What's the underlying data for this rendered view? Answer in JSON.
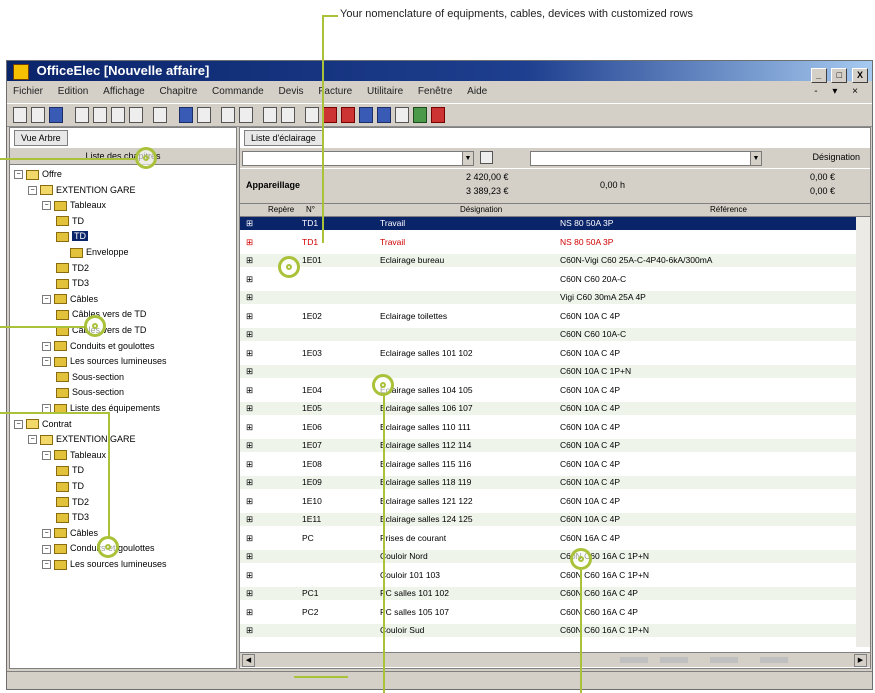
{
  "annotation": {
    "text": "Your nomenclature of equipments, cables, devices with customized rows"
  },
  "window": {
    "title": "OfficeElec   [Nouvelle affaire]",
    "controls": [
      "_",
      "□",
      "X"
    ]
  },
  "menubar": {
    "items": [
      "Fichier",
      "Edition",
      "Affichage",
      "Chapitre",
      "Commande",
      "Devis",
      "Facture",
      "Utilitaire",
      "Fenêtre",
      "Aide"
    ],
    "mdi_controls": "- ▾ ×"
  },
  "left_pane": {
    "tab": "Vue Arbre",
    "header": "Liste des chapitres",
    "tree": [
      {
        "label": "Offre",
        "depth": 0
      },
      {
        "label": "EXTENTION GARE",
        "depth": 1
      },
      {
        "label": "Tableaux",
        "depth": 2
      },
      {
        "label": "TD",
        "depth": 3
      },
      {
        "label": "TD",
        "depth": 3
      },
      {
        "label": "Enveloppe",
        "depth": 4
      },
      {
        "label": "TD2",
        "depth": 3
      },
      {
        "label": "TD3",
        "depth": 3
      },
      {
        "label": "Câbles",
        "depth": 2
      },
      {
        "label": "Câbles vers de TD",
        "depth": 3
      },
      {
        "label": "Câbles vers de TD",
        "depth": 3
      },
      {
        "label": "Conduits et goulottes",
        "depth": 2
      },
      {
        "label": "Les sources lumineuses",
        "depth": 2
      },
      {
        "label": "Sous-section",
        "depth": 3
      },
      {
        "label": "Sous-section",
        "depth": 3
      },
      {
        "label": "Liste des équipements",
        "depth": 2
      },
      {
        "label": "Contrat",
        "depth": 0
      },
      {
        "label": "EXTENTION GARE",
        "depth": 1
      },
      {
        "label": "Tableaux",
        "depth": 2
      },
      {
        "label": "TD",
        "depth": 3
      },
      {
        "label": "TD",
        "depth": 3
      },
      {
        "label": "TD2",
        "depth": 3
      },
      {
        "label": "TD3",
        "depth": 3
      },
      {
        "label": "Câbles",
        "depth": 2
      },
      {
        "label": "Conduits et goulottes",
        "depth": 2
      },
      {
        "label": "Les sources lumineuses",
        "depth": 2
      }
    ]
  },
  "right_pane": {
    "tab": "Liste d'éclairage",
    "filter_label": "Désignation",
    "summary": {
      "title": "Appareillage",
      "value_top": "2 420,00 €",
      "value_bottom": "3 389,23 €",
      "mid": "0,00 h",
      "right_top": "0,00 €",
      "right_bottom": "0,00 €"
    },
    "columns": [
      "Repère",
      "N°",
      "Désignation",
      "Référence"
    ],
    "rows": [
      {
        "ref": "TD1",
        "name": "Travail",
        "detail": "NS 80 50A 3P",
        "style": "sel"
      },
      {
        "ref": "TD1",
        "name": "Travail",
        "detail": "NS 80 50A 3P",
        "style": "red"
      },
      {
        "ref": "1E01",
        "name": "Eclairage bureau",
        "detail": "C60N-Vigi C60 25A-C-4P40-6kA/300mA",
        "style": "alt"
      },
      {
        "ref": "",
        "name": "",
        "detail": "C60N C60 20A-C",
        "style": ""
      },
      {
        "ref": "",
        "name": "",
        "detail": "Vigi C60 30mA 25A 4P",
        "style": "alt"
      },
      {
        "ref": "1E02",
        "name": "Eclairage toilettes",
        "detail": "C60N 10A C 4P",
        "style": ""
      },
      {
        "ref": "",
        "name": "",
        "detail": "C60N C60 10A-C",
        "style": "alt"
      },
      {
        "ref": "1E03",
        "name": "Eclairage salles 101 102",
        "detail": "C60N 10A C 4P",
        "style": ""
      },
      {
        "ref": "",
        "name": "",
        "detail": "C60N 10A C 1P+N",
        "style": "alt"
      },
      {
        "ref": "1E04",
        "name": "Eclairage salles 104 105",
        "detail": "C60N 10A C 4P",
        "style": ""
      },
      {
        "ref": "1E05",
        "name": "Eclairage salles 106 107",
        "detail": "C60N 10A C 4P",
        "style": "alt"
      },
      {
        "ref": "1E06",
        "name": "Eclairage salles 110 111",
        "detail": "C60N 10A C 4P",
        "style": ""
      },
      {
        "ref": "1E07",
        "name": "Eclairage salles 112 114",
        "detail": "C60N 10A C 4P",
        "style": "alt"
      },
      {
        "ref": "1E08",
        "name": "Eclairage salles 115 116",
        "detail": "C60N 10A C 4P",
        "style": ""
      },
      {
        "ref": "1E09",
        "name": "Eclairage salles 118 119",
        "detail": "C60N 10A C 4P",
        "style": "alt"
      },
      {
        "ref": "1E10",
        "name": "Eclairage salles 121 122",
        "detail": "C60N 10A C 4P",
        "style": ""
      },
      {
        "ref": "1E11",
        "name": "Eclairage salles 124 125",
        "detail": "C60N 10A C 4P",
        "style": "alt"
      },
      {
        "ref": "PC",
        "name": "Prises de courant",
        "detail": "C60N 16A C 4P",
        "style": ""
      },
      {
        "ref": "",
        "name": "Couloir Nord",
        "detail": "C60N C60 16A C 1P+N",
        "style": "alt"
      },
      {
        "ref": "",
        "name": "Couloir 101 103",
        "detail": "C60N C60 16A C 1P+N",
        "style": ""
      },
      {
        "ref": "PC1",
        "name": "PC salles 101 102",
        "detail": "C60N C60 16A C 4P",
        "style": "alt"
      },
      {
        "ref": "PC2",
        "name": "PC salles 105 107",
        "detail": "C60N C60 16A C 4P",
        "style": ""
      },
      {
        "ref": "",
        "name": "Couloir Sud",
        "detail": "C60N C60 16A C 1P+N",
        "style": "alt"
      }
    ]
  },
  "colors": {
    "title_start": "#0a246a",
    "title_end": "#a6caf0",
    "accent_callout": "#a9c23a",
    "selected_row": "#0a246a",
    "red_row": "#d00000",
    "alt_row": "#eef4ea"
  }
}
